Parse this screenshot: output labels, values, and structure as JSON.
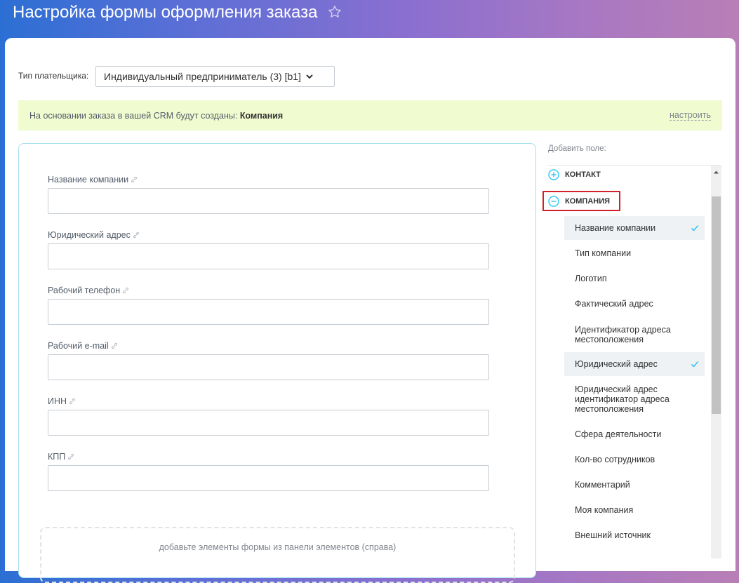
{
  "header": {
    "title": "Настройка формы оформления заказа",
    "star_icon": "star-outline-icon"
  },
  "payer": {
    "label": "Тип плательщика:",
    "selected": "Индивидуальный предприниматель (3) [b1]"
  },
  "info": {
    "text": "На основании заказа в вашей CRM будут созданы: ",
    "entity": "Компания",
    "configure_label": "настроить"
  },
  "form": {
    "fields": [
      {
        "label": "Название компании",
        "value": ""
      },
      {
        "label": "Юридический адрес",
        "value": ""
      },
      {
        "label": "Рабочий телефон",
        "value": ""
      },
      {
        "label": "Рабочий e-mail",
        "value": ""
      },
      {
        "label": "ИНН",
        "value": ""
      },
      {
        "label": "КПП",
        "value": ""
      }
    ],
    "dropzone_text": "добавьте элементы формы из панели элементов (справа)"
  },
  "sidebar": {
    "title": "Добавить поле:",
    "groups": [
      {
        "label": "КОНТАКТ",
        "state": "collapsed"
      },
      {
        "label": "КОМПАНИЯ",
        "state": "expanded"
      }
    ],
    "items": [
      {
        "label": "Название компании",
        "selected": true
      },
      {
        "label": "Тип компании",
        "selected": false
      },
      {
        "label": "Логотип",
        "selected": false
      },
      {
        "label": "Фактический адрес",
        "selected": false
      },
      {
        "label": "Идентификатор адреса местоположения",
        "selected": false
      },
      {
        "label": "Юридический адрес",
        "selected": true
      },
      {
        "label": "Юридический адрес идентификатор адреса местоположения",
        "selected": false
      },
      {
        "label": "Сфера деятельности",
        "selected": false
      },
      {
        "label": "Кол-во сотрудников",
        "selected": false
      },
      {
        "label": "Комментарий",
        "selected": false
      },
      {
        "label": "Моя компания",
        "selected": false
      },
      {
        "label": "Внешний источник",
        "selected": false
      }
    ]
  },
  "colors": {
    "accent": "#2fc6f6",
    "highlight_border": "#d0202a",
    "info_bg": "#f1fbd0"
  }
}
